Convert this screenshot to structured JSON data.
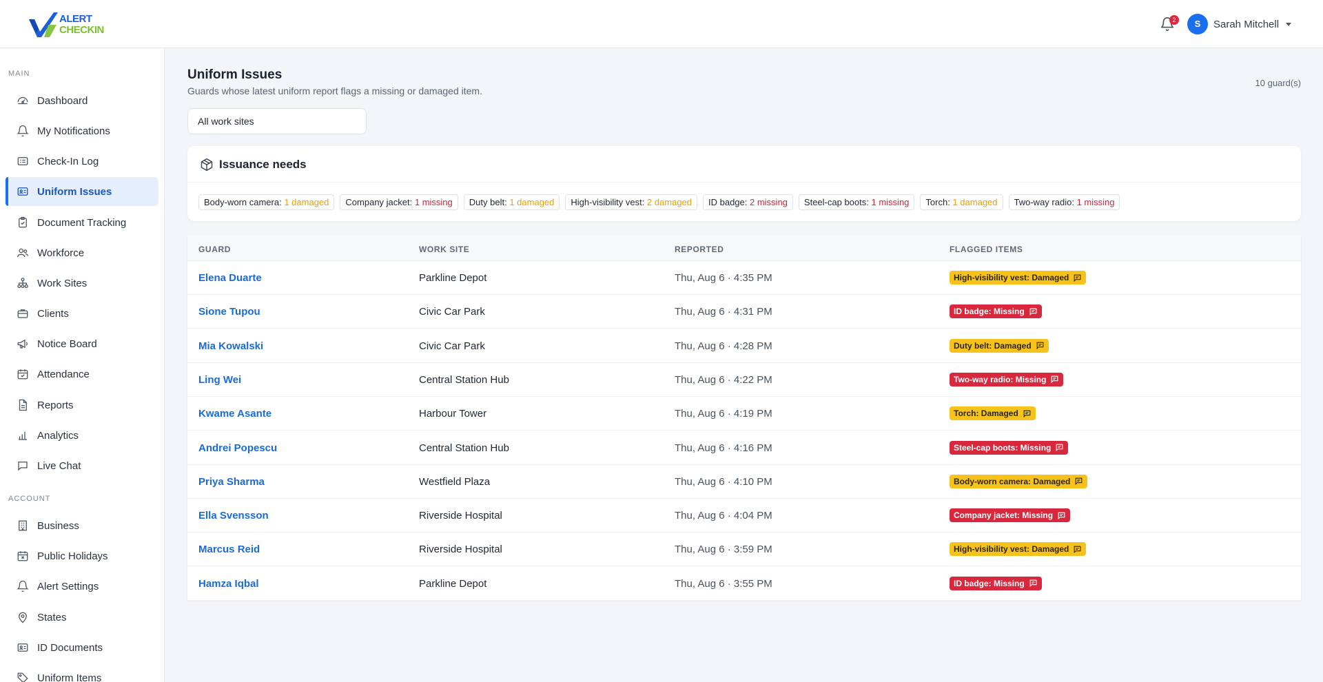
{
  "brand": {
    "line1": "ALERT",
    "line2": "CHECKIN",
    "primary": "#1d5fd8",
    "accent": "#7ac02b"
  },
  "header": {
    "notification_count": "2",
    "user_initial": "S",
    "user_name": "Sarah Mitchell"
  },
  "sidebar": {
    "main_label": "MAIN",
    "account_label": "ACCOUNT",
    "main_items": [
      {
        "label": "Dashboard",
        "icon": "dashboard-icon"
      },
      {
        "label": "My Notifications",
        "icon": "bell-icon"
      },
      {
        "label": "Check-In Log",
        "icon": "log-icon"
      },
      {
        "label": "Uniform Issues",
        "icon": "id-card-icon",
        "active": true
      },
      {
        "label": "Document Tracking",
        "icon": "clipboard-icon"
      },
      {
        "label": "Workforce",
        "icon": "people-icon"
      },
      {
        "label": "Work Sites",
        "icon": "sitemap-icon"
      },
      {
        "label": "Clients",
        "icon": "briefcase-icon"
      },
      {
        "label": "Notice Board",
        "icon": "megaphone-icon"
      },
      {
        "label": "Attendance",
        "icon": "calendar-check-icon"
      },
      {
        "label": "Reports",
        "icon": "document-icon"
      },
      {
        "label": "Analytics",
        "icon": "bar-chart-icon"
      },
      {
        "label": "Live Chat",
        "icon": "chat-icon"
      }
    ],
    "account_items": [
      {
        "label": "Business",
        "icon": "building-icon"
      },
      {
        "label": "Public Holidays",
        "icon": "calendar-x-icon"
      },
      {
        "label": "Alert Settings",
        "icon": "bell-icon"
      },
      {
        "label": "States",
        "icon": "map-pin-icon"
      },
      {
        "label": "ID Documents",
        "icon": "id-card-icon"
      },
      {
        "label": "Uniform Items",
        "icon": "tag-icon"
      }
    ]
  },
  "main": {
    "title": "Uniform Issues",
    "subtitle": "Guards whose latest uniform report flags a missing or damaged item.",
    "guard_count": "10 guard(s)",
    "site_filter": "All work sites"
  },
  "issuance": {
    "title": "Issuance needs",
    "chips": [
      {
        "item": "Body-worn camera:",
        "amount": "1 damaged",
        "status": "damaged"
      },
      {
        "item": "Company jacket:",
        "amount": "1 missing",
        "status": "missing"
      },
      {
        "item": "Duty belt:",
        "amount": "1 damaged",
        "status": "damaged"
      },
      {
        "item": "High-visibility vest:",
        "amount": "2 damaged",
        "status": "damaged"
      },
      {
        "item": "ID badge:",
        "amount": "2 missing",
        "status": "missing"
      },
      {
        "item": "Steel-cap boots:",
        "amount": "1 missing",
        "status": "missing"
      },
      {
        "item": "Torch:",
        "amount": "1 damaged",
        "status": "damaged"
      },
      {
        "item": "Two-way radio:",
        "amount": "1 missing",
        "status": "missing"
      }
    ],
    "colors": {
      "damaged": "#f6c21c",
      "missing": "#d7283d"
    }
  },
  "table": {
    "headers": [
      "GUARD",
      "WORK SITE",
      "REPORTED",
      "FLAGGED ITEMS"
    ],
    "rows": [
      {
        "guard": "Elena Duarte",
        "site": "Parkline Depot",
        "reported": "Thu, Aug 6 · 4:35 PM",
        "flag": "High-visibility vest: Damaged",
        "status": "damaged"
      },
      {
        "guard": "Sione Tupou",
        "site": "Civic Car Park",
        "reported": "Thu, Aug 6 · 4:31 PM",
        "flag": "ID badge: Missing",
        "status": "missing"
      },
      {
        "guard": "Mia Kowalski",
        "site": "Civic Car Park",
        "reported": "Thu, Aug 6 · 4:28 PM",
        "flag": "Duty belt: Damaged",
        "status": "damaged"
      },
      {
        "guard": "Ling Wei",
        "site": "Central Station Hub",
        "reported": "Thu, Aug 6 · 4:22 PM",
        "flag": "Two-way radio: Missing",
        "status": "missing"
      },
      {
        "guard": "Kwame Asante",
        "site": "Harbour Tower",
        "reported": "Thu, Aug 6 · 4:19 PM",
        "flag": "Torch: Damaged",
        "status": "damaged"
      },
      {
        "guard": "Andrei Popescu",
        "site": "Central Station Hub",
        "reported": "Thu, Aug 6 · 4:16 PM",
        "flag": "Steel-cap boots: Missing",
        "status": "missing"
      },
      {
        "guard": "Priya Sharma",
        "site": "Westfield Plaza",
        "reported": "Thu, Aug 6 · 4:10 PM",
        "flag": "Body-worn camera: Damaged",
        "status": "damaged"
      },
      {
        "guard": "Ella Svensson",
        "site": "Riverside Hospital",
        "reported": "Thu, Aug 6 · 4:04 PM",
        "flag": "Company jacket: Missing",
        "status": "missing"
      },
      {
        "guard": "Marcus Reid",
        "site": "Riverside Hospital",
        "reported": "Thu, Aug 6 · 3:59 PM",
        "flag": "High-visibility vest: Damaged",
        "status": "damaged"
      },
      {
        "guard": "Hamza Iqbal",
        "site": "Parkline Depot",
        "reported": "Thu, Aug 6 · 3:55 PM",
        "flag": "ID badge: Missing",
        "status": "missing"
      }
    ]
  }
}
